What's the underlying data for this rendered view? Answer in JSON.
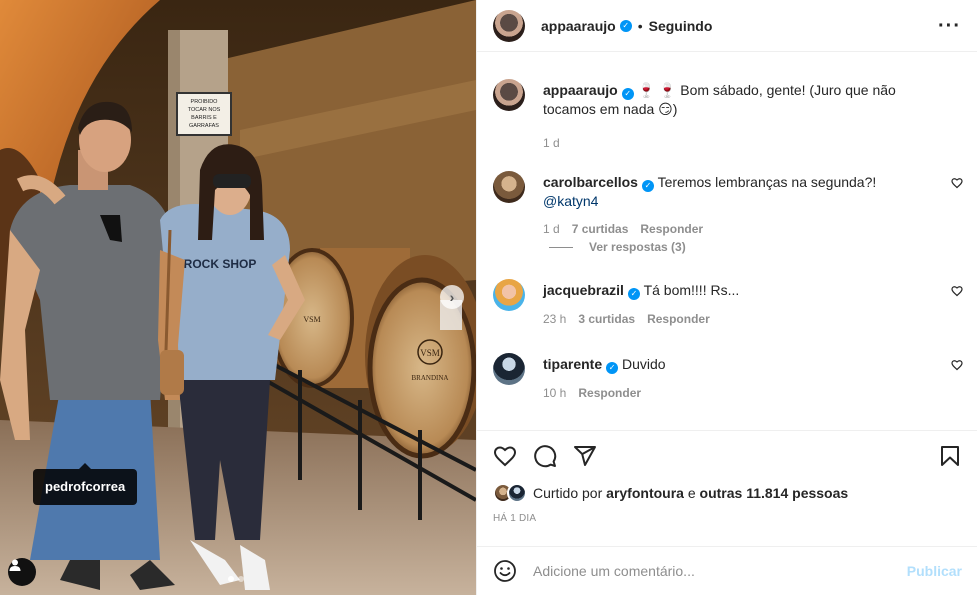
{
  "photo": {
    "tag_label": "pedrofcorrea",
    "sign_text": "PROIBIDO TOCAR NOS BARRIS E GARRAFAS",
    "shirt_text": "ROCK SHOP",
    "barrel_brand": "BRANDINA",
    "barrel_logo": "VSM",
    "next_icon": "chevron-right-icon",
    "tagged_icon": "user-icon"
  },
  "header": {
    "username": "appaaraujo",
    "separator": "•",
    "follow_state": "Seguindo",
    "more_icon": "more-horizontal-icon"
  },
  "caption": {
    "username": "appaaraujo",
    "text": "🍷 🍷 Bom sábado, gente! (Juro que não tocamos em nada 😏)",
    "time": "1 d"
  },
  "comments": [
    {
      "username": "carolbarcellos",
      "text": "Teremos lembranças na segunda?! ",
      "mention": "@katyn4",
      "time": "1 d",
      "likes": "7 curtidas",
      "reply": "Responder",
      "view_replies": "Ver respostas (3)"
    },
    {
      "username": "jacquebrazil",
      "text": "Tá bom!!!! Rs...",
      "time": "23 h",
      "likes": "3 curtidas",
      "reply": "Responder"
    },
    {
      "username": "tiparente",
      "text": "Duvido",
      "time": "10 h",
      "reply": "Responder"
    }
  ],
  "actions": {
    "liked_by_prefix": "Curtido por",
    "liked_by_user": "aryfontoura",
    "liked_by_joiner": "e",
    "liked_by_others": "outras 11.814 pessoas",
    "posted_ago": "HÁ 1 DIA"
  },
  "add_comment": {
    "placeholder": "Adicione um comentário...",
    "publish_label": "Publicar"
  },
  "colors": {
    "verified": "#0095f6",
    "secondary_text": "#8e8e8e",
    "link": "#00376b",
    "publish_disabled": "#b2dffc"
  }
}
